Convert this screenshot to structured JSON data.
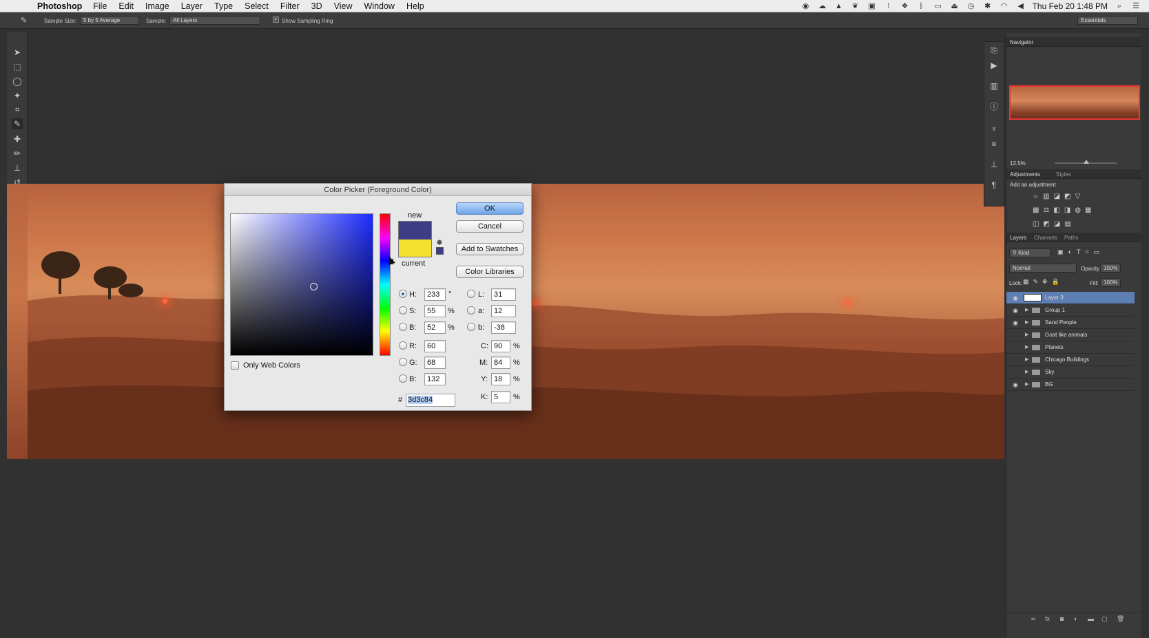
{
  "menubar": {
    "app": "Photoshop",
    "items": [
      "File",
      "Edit",
      "Image",
      "Layer",
      "Type",
      "Select",
      "Filter",
      "3D",
      "View",
      "Window",
      "Help"
    ],
    "clock": "Thu Feb 20  1:48 PM"
  },
  "options": {
    "sample_size_label": "Sample Size:",
    "sample_size_value": "5 by 5 Average",
    "sample_label": "Sample:",
    "sample_value": "All Layers",
    "show_ring_label": "Show Sampling Ring",
    "workspace": "Essentials"
  },
  "navigator": {
    "title": "Navigator",
    "zoom": "12.5%"
  },
  "adjustments": {
    "tabs": [
      "Adjustments",
      "Styles"
    ],
    "subtitle": "Add an adjustment"
  },
  "layers_panel": {
    "tabs": [
      "Layers",
      "Channels",
      "Paths"
    ],
    "filter": "Kind",
    "blend_mode": "Normal",
    "opacity_label": "Opacity:",
    "opacity": "100%",
    "lock_label": "Lock:",
    "fill_label": "Fill:",
    "fill": "100%",
    "layers": [
      {
        "name": "Layer 3",
        "visible": true,
        "selected": true,
        "group": false
      },
      {
        "name": "Group 1",
        "visible": true,
        "selected": false,
        "group": true
      },
      {
        "name": "Sand People",
        "visible": true,
        "selected": false,
        "group": true
      },
      {
        "name": "Goat like animals",
        "visible": false,
        "selected": false,
        "group": true
      },
      {
        "name": "Planets",
        "visible": false,
        "selected": false,
        "group": true
      },
      {
        "name": "Chicago Buildings",
        "visible": false,
        "selected": false,
        "group": true
      },
      {
        "name": "Sky",
        "visible": false,
        "selected": false,
        "group": true
      },
      {
        "name": "BG",
        "visible": true,
        "selected": false,
        "group": true
      }
    ]
  },
  "color_picker": {
    "title": "Color Picker (Foreground Color)",
    "new_label": "new",
    "current_label": "current",
    "buttons": {
      "ok": "OK",
      "cancel": "Cancel",
      "add_swatches": "Add to Swatches",
      "libraries": "Color Libraries"
    },
    "only_web_colors": "Only Web Colors",
    "new_color": "#3d3c84",
    "current_color": "#f4e02f",
    "hsb": {
      "h_label": "H:",
      "h": "233",
      "h_unit": "°",
      "s_label": "S:",
      "s": "55",
      "s_unit": "%",
      "b_label": "B:",
      "b": "52",
      "b_unit": "%"
    },
    "rgb": {
      "r_label": "R:",
      "r": "60",
      "g_label": "G:",
      "g": "68",
      "b_label": "B:",
      "b": "132"
    },
    "lab": {
      "l_label": "L:",
      "l": "31",
      "a_label": "a:",
      "a": "12",
      "b_label": "b:",
      "b": "-38"
    },
    "cmyk": {
      "c_label": "C:",
      "c": "90",
      "m_label": "M:",
      "m": "84",
      "y_label": "Y:",
      "y": "18",
      "k_label": "K:",
      "k": "5",
      "unit": "%"
    },
    "hex_label": "#",
    "hex": "3d3c84"
  }
}
